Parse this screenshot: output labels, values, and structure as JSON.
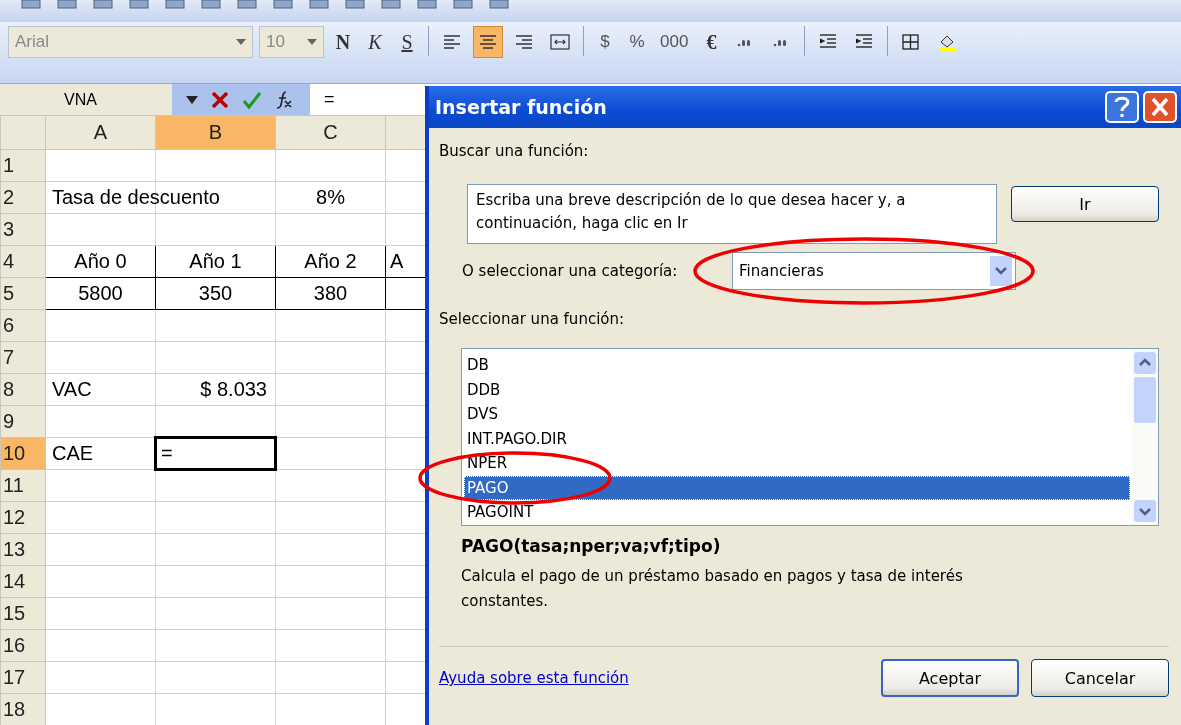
{
  "formatting_toolbar": {
    "font": "Arial",
    "size": "10",
    "buttons": [
      {
        "kind": "text",
        "label": "N",
        "selected": false
      },
      {
        "kind": "text",
        "label": "K",
        "selected": false
      },
      {
        "kind": "text",
        "label": "S",
        "selected": false
      },
      {
        "kind": "sep"
      },
      {
        "kind": "icon",
        "selected": false
      },
      {
        "kind": "icon",
        "selected": true
      },
      {
        "kind": "icon",
        "selected": false
      },
      {
        "kind": "icon",
        "selected": false
      },
      {
        "kind": "sep"
      },
      {
        "kind": "text",
        "label": "$",
        "selected": false
      },
      {
        "kind": "text",
        "label": "%",
        "selected": false
      },
      {
        "kind": "text",
        "label": "000",
        "selected": false
      },
      {
        "kind": "text",
        "label": "€",
        "selected": false
      },
      {
        "kind": "icon",
        "selected": false
      },
      {
        "kind": "icon",
        "selected": false
      },
      {
        "kind": "sep"
      },
      {
        "kind": "icon",
        "selected": false
      },
      {
        "kind": "icon",
        "selected": false
      },
      {
        "kind": "sep"
      },
      {
        "kind": "icon",
        "selected": false
      },
      {
        "kind": "icon",
        "selected": false
      }
    ]
  },
  "formula_bar": {
    "name_box": "VNA",
    "formula": "="
  },
  "sheet": {
    "columns": [
      {
        "label": "A",
        "selected": false
      },
      {
        "label": "B",
        "selected": true
      },
      {
        "label": "C",
        "selected": false
      }
    ],
    "rows": [
      {
        "number": "1",
        "selected": false,
        "bordered": false,
        "cells": [
          "",
          "",
          "",
          ""
        ]
      },
      {
        "number": "2",
        "selected": false,
        "bordered": false,
        "cells": [
          "Tasa de descuento",
          "",
          "8%",
          ""
        ]
      },
      {
        "number": "3",
        "selected": false,
        "bordered": false,
        "cells": [
          "",
          "",
          "",
          ""
        ]
      },
      {
        "number": "4",
        "selected": false,
        "bordered": true,
        "cells": [
          "Año 0",
          "Año 1",
          "Año 2",
          "A"
        ]
      },
      {
        "number": "5",
        "selected": false,
        "bordered": true,
        "cells": [
          "5800",
          "350",
          "380",
          ""
        ]
      },
      {
        "number": "6",
        "selected": false,
        "bordered": false,
        "cells": [
          "",
          "",
          "",
          ""
        ]
      },
      {
        "number": "7",
        "selected": false,
        "bordered": false,
        "cells": [
          "",
          "",
          "",
          ""
        ]
      },
      {
        "number": "8",
        "selected": false,
        "bordered": false,
        "cells": [
          "VAC",
          "$ 8.033",
          "",
          ""
        ]
      },
      {
        "number": "9",
        "selected": false,
        "bordered": false,
        "cells": [
          "",
          "",
          "",
          ""
        ]
      },
      {
        "number": "10",
        "selected": true,
        "bordered": false,
        "cells": [
          "CAE",
          "=",
          "",
          ""
        ]
      },
      {
        "number": "11",
        "selected": false,
        "bordered": false,
        "cells": [
          "",
          "",
          "",
          ""
        ]
      },
      {
        "number": "12",
        "selected": false,
        "bordered": false,
        "cells": [
          "",
          "",
          "",
          ""
        ]
      },
      {
        "number": "13",
        "selected": false,
        "bordered": false,
        "cells": [
          "",
          "",
          "",
          ""
        ]
      },
      {
        "number": "14",
        "selected": false,
        "bordered": false,
        "cells": [
          "",
          "",
          "",
          ""
        ]
      },
      {
        "number": "15",
        "selected": false,
        "bordered": false,
        "cells": [
          "",
          "",
          "",
          ""
        ]
      },
      {
        "number": "16",
        "selected": false,
        "bordered": false,
        "cells": [
          "",
          "",
          "",
          ""
        ]
      },
      {
        "number": "17",
        "selected": false,
        "bordered": false,
        "cells": [
          "",
          "",
          "",
          ""
        ]
      },
      {
        "number": "18",
        "selected": false,
        "bordered": false,
        "cells": [
          "",
          "",
          "",
          ""
        ]
      }
    ]
  },
  "dialog": {
    "title": "Insertar función",
    "search_label": "Buscar una función:",
    "search_value": "Escriba una breve descripción de lo que desea hacer y, a continuación, haga clic en Ir",
    "go_button": "Ir",
    "category_label": "O seleccionar una categoría:",
    "category": "Financieras",
    "list_label": "Seleccionar una función:",
    "functions": [
      {
        "name": "DB",
        "selected": false
      },
      {
        "name": "DDB",
        "selected": false
      },
      {
        "name": "DVS",
        "selected": false
      },
      {
        "name": "INT.PAGO.DIR",
        "selected": false
      },
      {
        "name": "NPER",
        "selected": false
      },
      {
        "name": "PAGO",
        "selected": true
      },
      {
        "name": "PAGOINT",
        "selected": false
      }
    ],
    "signature": "PAGO(tasa;nper;va;vf;tipo)",
    "description": "Calcula el pago de un préstamo basado en pagos y tasa de interés constantes.",
    "help_link": "Ayuda sobre esta función",
    "buttons": [
      {
        "label": "Aceptar",
        "default": true
      },
      {
        "label": "Cancelar",
        "default": false
      }
    ]
  }
}
